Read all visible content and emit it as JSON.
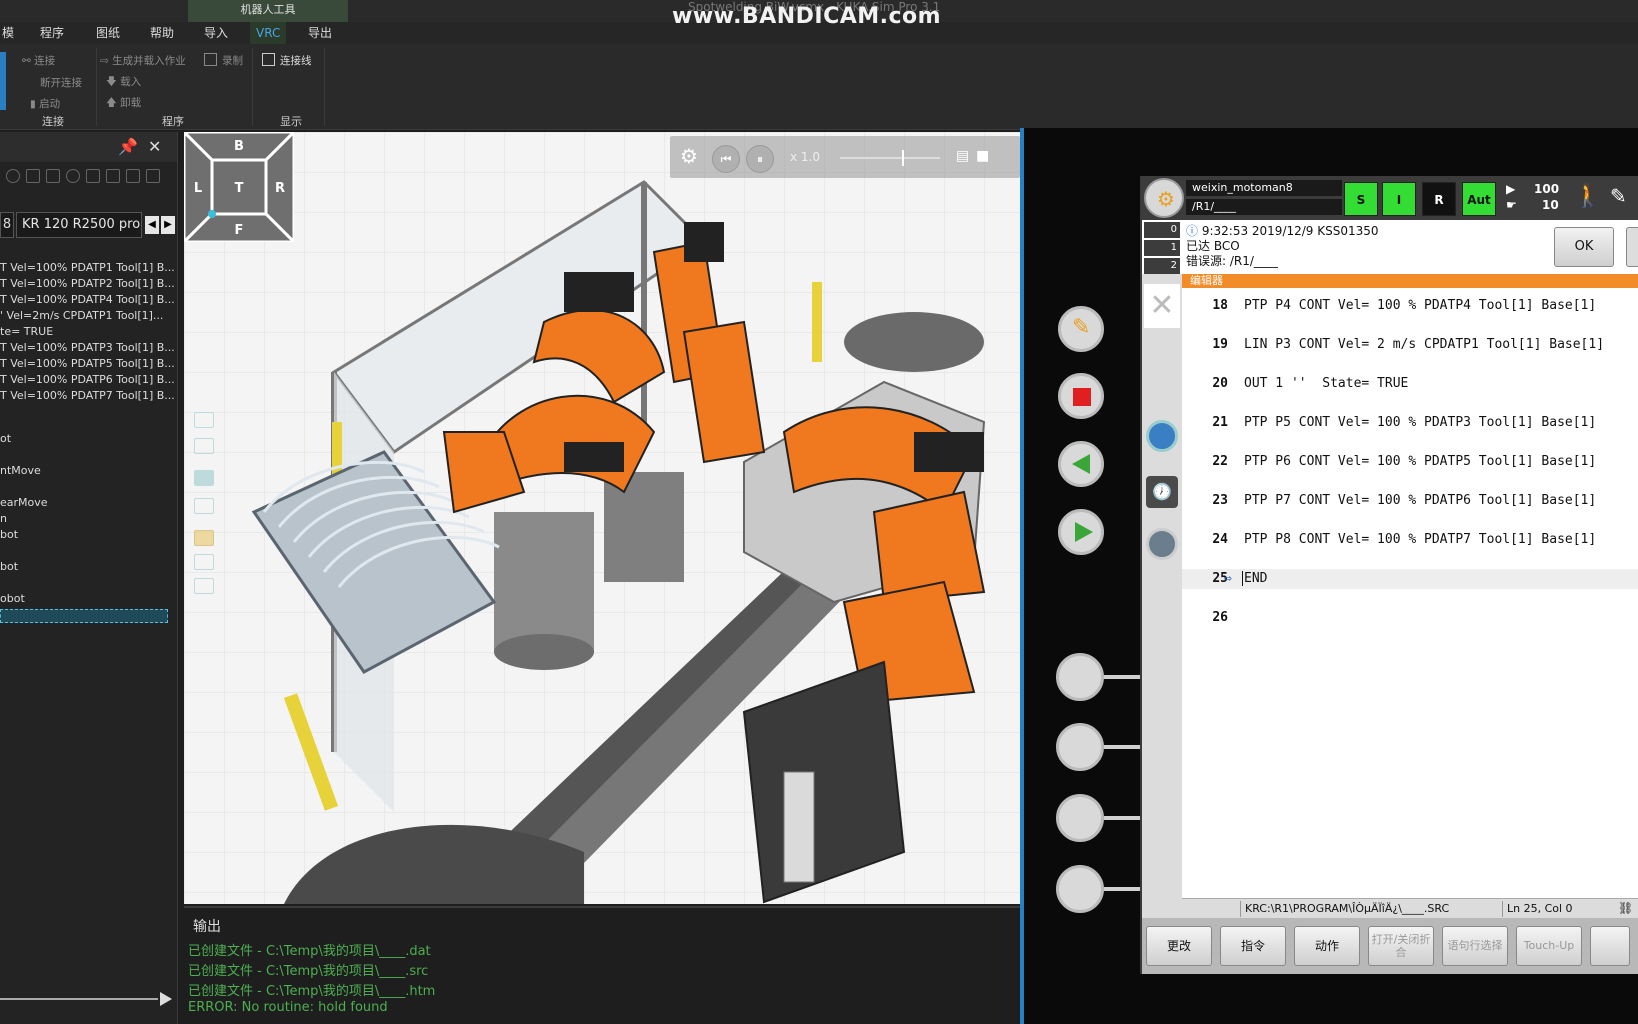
{
  "window": {
    "title": "Spotwelding BiW.vcmx - KUKA.Sim Pro 3.1",
    "watermark": "www.BANDICAM.com"
  },
  "ribbon": {
    "menu": [
      "模",
      "程序",
      "图纸",
      "帮助",
      "导入",
      "VRC",
      "导出"
    ],
    "robot_tools_label": "机器人工具",
    "connect": {
      "connect": "连接",
      "disconnect": "断开连接",
      "start": "启动",
      "group": "连接"
    },
    "program": {
      "generate": "生成并载入作业",
      "record": "录制",
      "load": "载入",
      "unload": "卸载",
      "group": "程序"
    },
    "display": {
      "connection_line": "连接线",
      "group": "显示"
    }
  },
  "left_panel": {
    "robot_index": "8",
    "robot_name": "KR 120 R2500 pro",
    "statements": [
      "T Vel=100% PDATP1 Tool[1] B...",
      "T Vel=100% PDATP2 Tool[1] B...",
      "T Vel=100% PDATP4 Tool[1] B...",
      "' Vel=2m/s CPDATP1 Tool[1]...",
      "te= TRUE",
      "T Vel=100% PDATP3 Tool[1] B...",
      "T Vel=100% PDATP5 Tool[1] B...",
      "T Vel=100% PDATP6 Tool[1] B...",
      "T Vel=100% PDATP7 Tool[1] B..."
    ],
    "actions": [
      "ot",
      "ntMove",
      "earMove",
      "n",
      "bot",
      "bot",
      "obot"
    ]
  },
  "viewport": {
    "speed": "x 1.0",
    "cube": {
      "top": "B",
      "left": "L",
      "center": "T",
      "right": "R",
      "bottom": "F"
    }
  },
  "output": {
    "title": "输出",
    "lines": [
      "已创建文件 - C:\\Temp\\我的项目\\____.dat",
      "已创建文件 - C:\\Temp\\我的项目\\____.src",
      "已创建文件 - C:\\Temp\\我的项目\\____.htm",
      "ERROR: No routine: hold found"
    ]
  },
  "hmi": {
    "robot_id": "weixin_motoman8",
    "path": "/R1/____",
    "status": {
      "s": "S",
      "i": "I",
      "r": "R",
      "aut": "Aut"
    },
    "override_top": "100",
    "override_bottom": "10",
    "msg_counts": [
      "0",
      "1",
      "2",
      "0"
    ],
    "message": {
      "time": "9:32:53 2019/12/9 KSS01350",
      "text": "已达 BCO",
      "source": "错误源: /R1/____"
    },
    "ok_label": "OK",
    "editor_label": "编辑器",
    "code": [
      {
        "ln": "18",
        "text": "PTP P4 CONT Vel= 100 % PDATP4 Tool[1] Base[1]"
      },
      {
        "ln": "19",
        "text": "LIN P3 CONT Vel= 2 m/s CPDATP1 Tool[1] Base[1]"
      },
      {
        "ln": "20",
        "text": "OUT 1 ''  State= TRUE"
      },
      {
        "ln": "21",
        "text": "PTP P5 CONT Vel= 100 % PDATP3 Tool[1] Base[1]"
      },
      {
        "ln": "22",
        "text": "PTP P6 CONT Vel= 100 % PDATP5 Tool[1] Base[1]"
      },
      {
        "ln": "23",
        "text": "PTP P7 CONT Vel= 100 % PDATP6 Tool[1] Base[1]"
      },
      {
        "ln": "24",
        "text": "PTP P8 CONT Vel= 100 % PDATP7 Tool[1] Base[1]"
      },
      {
        "ln": "25",
        "text": "END"
      },
      {
        "ln": "26",
        "text": ""
      }
    ],
    "statusbar": {
      "file": "KRC:\\R1\\PROGRAM\\ÎÒµÄÏîÄ¿\\____.SRC",
      "pos": "Ln 25, Col 0"
    },
    "softkeys": {
      "change": "更改",
      "command": "指令",
      "motion": "动作",
      "fold": "打开/关闭折合",
      "line_select": "语句行选择",
      "touch_up": "Touch-Up"
    },
    "colors": {
      "accent": "#f28c28",
      "led_green": "#33dd33"
    }
  }
}
